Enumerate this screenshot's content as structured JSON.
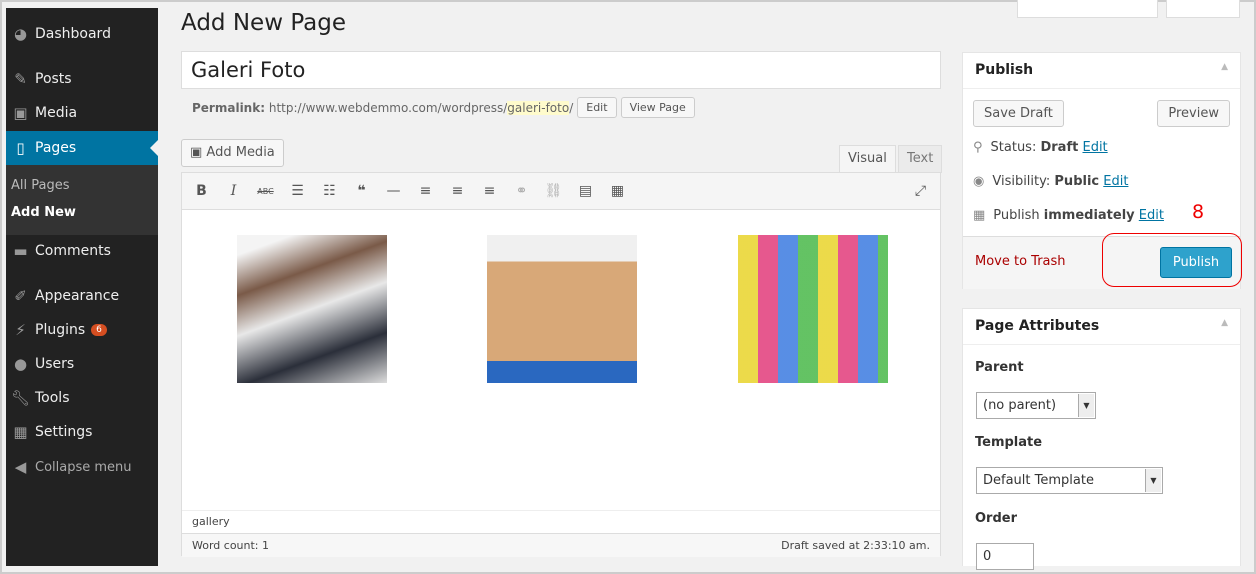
{
  "sidebar": {
    "items": [
      {
        "label": "Dashboard",
        "icon": "dashboard-icon"
      },
      {
        "label": "Posts",
        "icon": "pin-icon"
      },
      {
        "label": "Media",
        "icon": "media-icon"
      },
      {
        "label": "Pages",
        "icon": "pages-icon",
        "active": true
      },
      {
        "label": "Comments",
        "icon": "comment-icon"
      },
      {
        "label": "Appearance",
        "icon": "brush-icon"
      },
      {
        "label": "Plugins",
        "icon": "plugin-icon",
        "badge": "6"
      },
      {
        "label": "Users",
        "icon": "user-icon"
      },
      {
        "label": "Tools",
        "icon": "wrench-icon"
      },
      {
        "label": "Settings",
        "icon": "settings-icon"
      }
    ],
    "submenu": [
      "All Pages",
      "Add New"
    ],
    "collapse": "Collapse menu"
  },
  "page_title": "Add New Page",
  "post_title": "Galeri Foto",
  "permalink": {
    "label": "Permalink:",
    "base": "http://www.webdemmo.com/wordpress/",
    "slug": "galeri-foto",
    "trail": "/",
    "edit": "Edit",
    "view": "View Page"
  },
  "editor": {
    "add_media": "Add Media",
    "tabs": [
      "Visual",
      "Text"
    ],
    "path": "gallery",
    "word_count": "Word count: 1",
    "saved": "Draft saved at 2:33:10 am."
  },
  "publish": {
    "title": "Publish",
    "save_draft": "Save Draft",
    "preview": "Preview",
    "status_label": "Status:",
    "status": "Draft",
    "visibility_label": "Visibility:",
    "visibility": "Public",
    "publish_label": "Publish",
    "publish_when": "immediately",
    "edit": "Edit",
    "trash": "Move to Trash",
    "publish_button": "Publish",
    "annotation": "8"
  },
  "attributes": {
    "title": "Page Attributes",
    "parent_label": "Parent",
    "parent": "(no parent)",
    "template_label": "Template",
    "template": "Default Template",
    "order_label": "Order",
    "order": "0"
  },
  "colors": {
    "accent": "#0074a2",
    "button": "#2ea2cc",
    "annotation": "#ee0000"
  }
}
